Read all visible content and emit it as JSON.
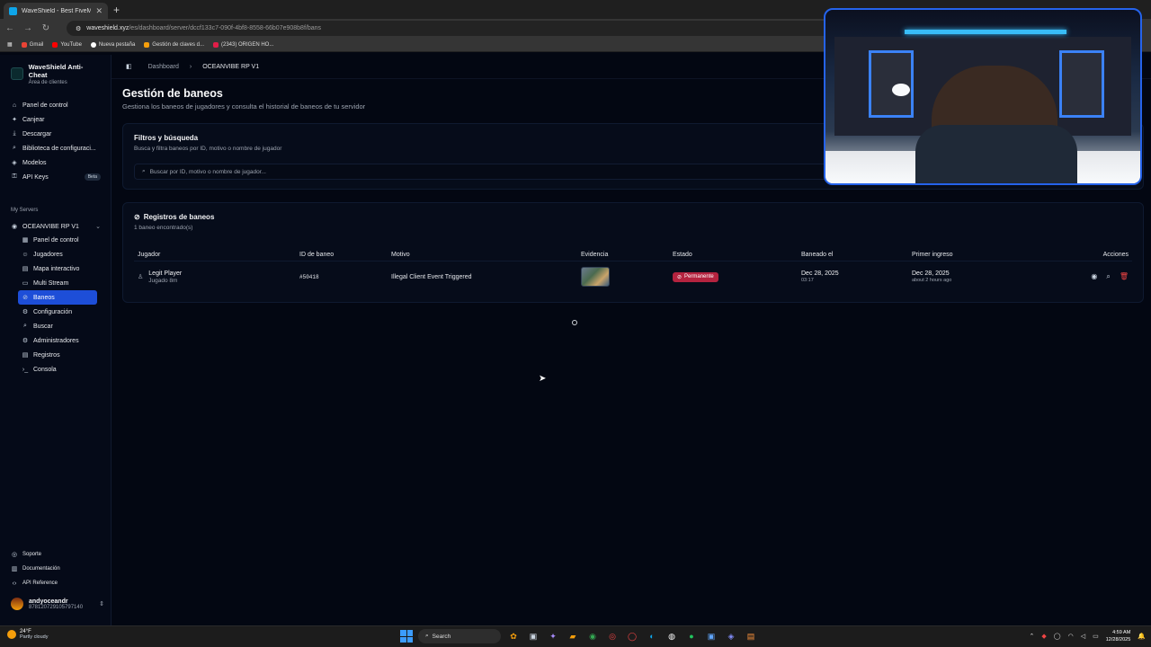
{
  "browser": {
    "tab_title": "WaveShield - Best FiveM Anti-C",
    "url_host": "waveshield.xyz",
    "url_path": "/es/dashboard/server/dccf133c7-090f-4bf8-8558-66b07e908b8f/bans",
    "bookmarks": [
      "Gmail",
      "YouTube",
      "Nueva pestaña",
      "Gestión de claves d...",
      "(2343) ORIGEN HO..."
    ]
  },
  "sidebar": {
    "brand_title": "WaveShield Anti-Cheat",
    "brand_sub": "Área de clientes",
    "items": [
      {
        "label": "Panel de control",
        "icon": "home-icon",
        "glyph": "⌂"
      },
      {
        "label": "Canjear",
        "icon": "gift-icon",
        "glyph": "✦"
      },
      {
        "label": "Descargar",
        "icon": "download-icon",
        "glyph": "⤓"
      },
      {
        "label": "Biblioteca de configuraci...",
        "icon": "search-icon",
        "glyph": "⌕"
      },
      {
        "label": "Modelos",
        "icon": "cube-icon",
        "glyph": "◈"
      },
      {
        "label": "API Keys",
        "icon": "key-icon",
        "glyph": "⚿",
        "badge": "Beta"
      }
    ],
    "section_label": "My Servers",
    "server_name": "OCEANVIBE RP V1",
    "server_items": [
      {
        "label": "Panel de control",
        "icon": "dashboard-icon",
        "glyph": "▦"
      },
      {
        "label": "Jugadores",
        "icon": "users-icon",
        "glyph": "☺"
      },
      {
        "label": "Mapa interactivo",
        "icon": "map-icon",
        "glyph": "▤"
      },
      {
        "label": "Multi Stream",
        "icon": "monitor-icon",
        "glyph": "▭"
      },
      {
        "label": "Baneos",
        "icon": "ban-icon",
        "glyph": "⊘",
        "active": true
      },
      {
        "label": "Configuración",
        "icon": "gear-icon",
        "glyph": "⚙"
      },
      {
        "label": "Buscar",
        "icon": "search-icon",
        "glyph": "⌕"
      },
      {
        "label": "Administradores",
        "icon": "gear-icon",
        "glyph": "⚙"
      },
      {
        "label": "Registros",
        "icon": "file-icon",
        "glyph": "▤"
      },
      {
        "label": "Consola",
        "icon": "terminal-icon",
        "glyph": "›_"
      }
    ],
    "bottom_items": [
      {
        "label": "Soporte",
        "icon": "support-icon",
        "glyph": "◎"
      },
      {
        "label": "Documentación",
        "icon": "book-icon",
        "glyph": "▥"
      },
      {
        "label": "API Reference",
        "icon": "code-icon",
        "glyph": "‹›"
      }
    ],
    "user_name": "andyoceandr",
    "user_id": "878120729105797140"
  },
  "main": {
    "breadcrumb_root": "Dashboard",
    "breadcrumb_current": "OCEANVIBE RP V1",
    "title": "Gestión de baneos",
    "subtitle": "Gestiona los baneos de jugadores y consulta el historial de baneos de tu servidor",
    "filters": {
      "title": "Filtros y búsqueda",
      "subtitle": "Busca y filtra baneos por ID, motivo o nombre de jugador",
      "search_placeholder": "Buscar por ID, motivo o nombre de jugador..."
    },
    "bans": {
      "title": "Registros de baneos",
      "count_text": "1 baneo encontrado(s)",
      "columns": [
        "Jugador",
        "ID de baneo",
        "Motivo",
        "Evidencia",
        "Estado",
        "Baneado el",
        "Primer ingreso",
        "Acciones"
      ],
      "rows": [
        {
          "player": "Legit Player",
          "played": "Jugado 8m",
          "ban_id": "#50418",
          "reason": "Illegal Client Event Triggered",
          "status": "Permanente",
          "banned_date": "Dec 28, 2025",
          "banned_time": "03:17",
          "first_join_date": "Dec 28, 2025",
          "first_join_rel": "about 2 hours ago"
        }
      ]
    }
  },
  "taskbar": {
    "temp": "24°F",
    "weather": "Partly cloudy",
    "search_label": "Search",
    "time": "4:59 AM",
    "date": "12/28/2025"
  },
  "colors": {
    "accent": "#1d4ed8",
    "status_permanent": "#b4233f",
    "background": "#030712"
  }
}
